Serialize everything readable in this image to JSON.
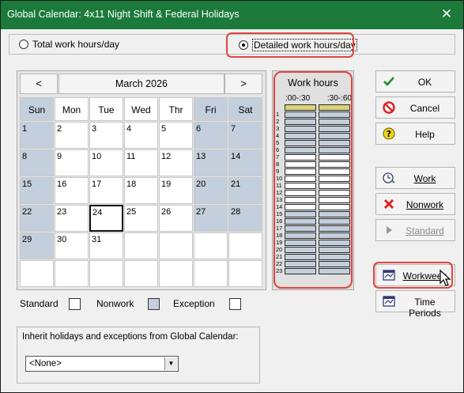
{
  "window": {
    "title": "Global Calendar: 4x11 Night Shift & Federal Holidays",
    "close_glyph": "✕"
  },
  "mode": {
    "options": [
      {
        "label": "Total work hours/day",
        "selected": false
      },
      {
        "label": "Detailed work hours/day",
        "selected": true
      }
    ]
  },
  "calendar": {
    "month": "March 2026",
    "prev": "<",
    "next": ">",
    "weekdays": [
      "Sun",
      "Mon",
      "Tue",
      "Wed",
      "Thr",
      "Fri",
      "Sat"
    ],
    "weeks": [
      [
        "1",
        "2",
        "3",
        "4",
        "5",
        "6",
        "7"
      ],
      [
        "8",
        "9",
        "10",
        "11",
        "12",
        "13",
        "14"
      ],
      [
        "15",
        "16",
        "17",
        "18",
        "19",
        "20",
        "21"
      ],
      [
        "22",
        "23",
        "24",
        "25",
        "26",
        "27",
        "28"
      ],
      [
        "29",
        "30",
        "31",
        "",
        "",
        "",
        ""
      ],
      [
        "",
        "",
        "",
        "",
        "",
        "",
        ""
      ]
    ],
    "selected_day": "24"
  },
  "work_hours": {
    "title": "Work hours",
    "col_labels": [
      ":00-:30",
      ":30-:60"
    ],
    "hours": [
      "1",
      "2",
      "3",
      "4",
      "5",
      "6",
      "7",
      "8",
      "9",
      "10",
      "11",
      "12",
      "13",
      "14",
      "15",
      "16",
      "17",
      "18",
      "19",
      "20",
      "21",
      "22",
      "23"
    ]
  },
  "legend": {
    "standard": "Standard",
    "nonwork": "Nonwork",
    "exception": "Exception"
  },
  "inherit": {
    "label": "Inherit holidays and exceptions from Global Calendar:",
    "value": "<None>"
  },
  "buttons": {
    "ok": "OK",
    "cancel": "Cancel",
    "help": "Help",
    "work": "Work",
    "nonwork": "Nonwork",
    "standard": "Standard",
    "workweek": "Workweek",
    "time_periods": "Time Periods"
  },
  "colors": {
    "titlebar": "#1b7a3a",
    "nonwork": "#c3cfdc",
    "highlight": "#e0453f",
    "header_cell": "#d8d27a"
  }
}
